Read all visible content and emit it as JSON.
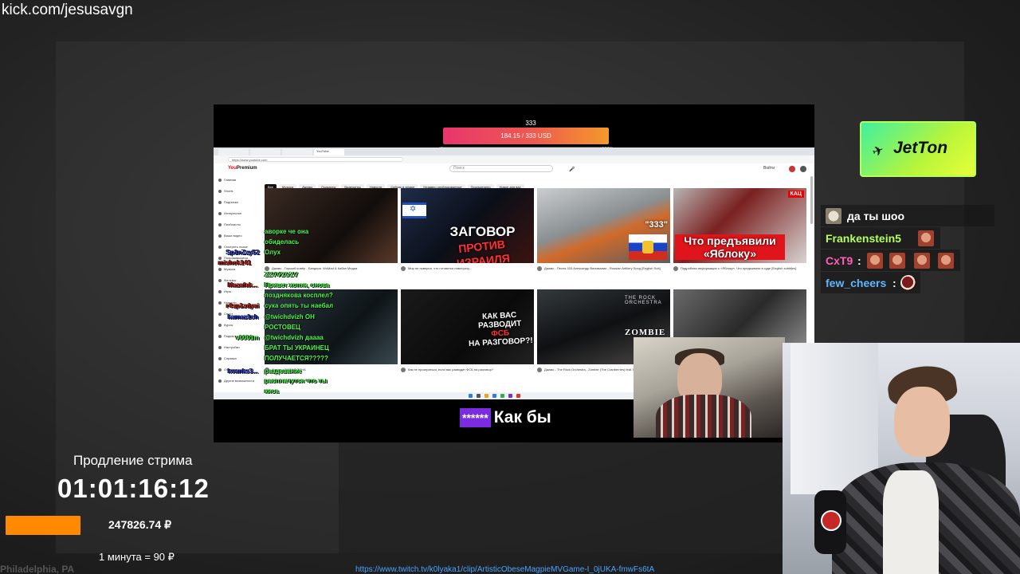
{
  "channel_url": "kick.com/jesusavgn",
  "donation_goal": {
    "count": "333",
    "progress_text": "184.15 / 333 USD",
    "progress_fraction": 0.553,
    "tick_start": "0",
    "tick_end": "332"
  },
  "browser": {
    "tabs": [
      "",
      "",
      "",
      "YouTube"
    ],
    "address": "https://www.youtube.com",
    "logo_prefix": "You",
    "logo_suffix": "Premium",
    "search_placeholder": "Поиск",
    "signin": "Войти",
    "chips": [
      "Все",
      "Музыка",
      "Джемы",
      "Подкасты",
      "Видеоигры",
      "Новости",
      "Сейчас в эфире",
      "Недавно опубликованные",
      "Просмотрено",
      "Новое для вас"
    ],
    "sidebar": [
      "Главная",
      "Shorts",
      "Подписки",
      "Интересное",
      "Плейлисты",
      "Ваши видео",
      "Смотреть позже",
      "Понравившиеся",
      "Музыка",
      "Фильмы",
      "Игры",
      "Новости",
      "Спорт",
      "Курсы",
      "Подкасты",
      "Настройки",
      "Справка",
      "Отправить отзыв",
      "Другие возможности"
    ],
    "thumbnails": {
      "t2_title": "ЗАГОВОР",
      "t2_sub": "ПРОТИВ ИЗРАИЛЯ",
      "t3_num": "\"333\"",
      "t4_title": "Что предъявили «Яблоку»",
      "t4_badge": "КАЦ",
      "t6_line1": "КАК ВАС РАЗВОДИТ",
      "t6_line2": "ФСБ",
      "t6_line3": "НА РАЗГОВОР?!",
      "t7_brand": "THE ROCK ORCHESTRA",
      "t7_title": "ZOMBIE"
    },
    "meta": [
      "Джамс - Горький ковёр - Бандера. WoMad & Кабан Медиа",
      "Мир не поверил, что готовится навстрочу...",
      "Джамс - Песня 333 Александр Винимании - Russian Artillery Song [English Sub]",
      "Подробная информация о «Яблоку». Что предъявили в суде [English subtitles]",
      "Джамс - ЖИВАЯ ЗОНА",
      "Как не проиграться, если вас разводит ФСБ на разговор?",
      "Джамс - The Rock Orchestra - Zombie (The Cranberries) feat. Elen Fox"
    ]
  },
  "overlay_chat": [
    {
      "text": "аворке че она",
      "style": "green"
    },
    {
      "text": "обиделась",
      "style": "green"
    },
    {
      "text": "Олух",
      "style": "green"
    },
    {
      "text": "Sp1nZzy52",
      "style": "blue"
    },
    {
      "text": "mishok141",
      "style": "red"
    },
    {
      "text": "ZZVVZOZV",
      "style": "green"
    },
    {
      "text": "Привет хопяк, снова",
      "style": "green"
    },
    {
      "text": "Mazafak...",
      "style": "red"
    },
    {
      "text": "позднякова косплел?",
      "style": "green"
    },
    {
      "text": "сука опять ты наебал",
      "style": "green"
    },
    {
      "text": "r4sp1zdyai",
      "style": "red"
    },
    {
      "text": "kamaz1ch",
      "style": "blue"
    },
    {
      "text": "@twichdvizh ОН",
      "style": "green"
    },
    {
      "text": "РОСТОВЕЦ",
      "style": "green"
    },
    {
      "text": "v0001m",
      "style": "green"
    },
    {
      "text": "@twichdvizh даааа",
      "style": "green"
    },
    {
      "text": "БРАТ ТЫ УКРАИНЕЦ",
      "style": "green"
    },
    {
      "text": "kvanks3...",
      "style": "blue"
    },
    {
      "text": "ПОЛУЧАЕТСЯ?????",
      "style": "green"
    },
    {
      "text": "раздевание",
      "style": "green"
    },
    {
      "text": "расплачутся что ты",
      "style": "green"
    },
    {
      "text": "киса",
      "style": "green"
    }
  ],
  "subtitle": {
    "mask": "******",
    "text": "Как бы"
  },
  "sponsor": {
    "name": "JetTon",
    "logo_glyph": "✈"
  },
  "chat": [
    {
      "user": "",
      "message": "да ты шоо",
      "emotes": 0
    },
    {
      "user": "Frankenstein5",
      "message": ":",
      "emotes": 1
    },
    {
      "user": "CxT9",
      "message": ":",
      "emotes": 4
    },
    {
      "user": "few_cheers",
      "message": ":",
      "emotes": 1
    }
  ],
  "extension": {
    "label": "Продление стрима",
    "timer": "01:01:16:12",
    "amount": "247826.74 ₽",
    "rate": "1 минута = 90 ₽"
  },
  "clip_url": "https://www.twitch.tv/k0lyaka1/clip/ArtisticObeseMagpieMVGame-I_0jUKA-fmwFs6tA",
  "bg_city": "Philadelphia, PA",
  "colors": {
    "goal_gradient": [
      "#e8366d",
      "#f39a2a"
    ],
    "subtitle_mask": "#7b2ce0",
    "jetton_gradient": [
      "#3ff0a0",
      "#e8ff3a"
    ],
    "extension_bar": "#ff8a00",
    "clip_link": "#4aa3ff"
  }
}
